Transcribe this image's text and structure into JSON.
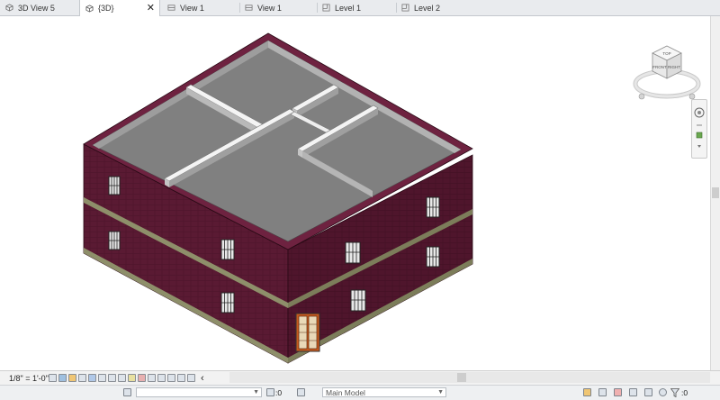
{
  "tabs": [
    {
      "label": "3D View 5",
      "active": false,
      "closable": false,
      "icon": "3d-view-icon"
    },
    {
      "label": "{3D}",
      "active": true,
      "closable": true,
      "icon": "3d-view-icon"
    },
    {
      "label": "View 1",
      "active": false,
      "closable": false,
      "icon": "section-view-icon"
    },
    {
      "label": "View 1",
      "active": false,
      "closable": false,
      "icon": "section-view-icon"
    },
    {
      "label": "Level 1",
      "active": false,
      "closable": false,
      "icon": "floor-plan-icon"
    },
    {
      "label": "Level 2",
      "active": false,
      "closable": false,
      "icon": "floor-plan-icon"
    }
  ],
  "close_glyph": "✕",
  "viewcube": {
    "top_label": "TOP",
    "front_label": "FRONT",
    "right_label": "RIGHT"
  },
  "view_control_bar": {
    "scale": "1/8\" = 1'-0\"",
    "collapse_arrow": "‹"
  },
  "status_bar": {
    "workset_value": "",
    "editable_count": ":0",
    "model_value": "Main Model",
    "filter_count": ":0"
  },
  "colors": {
    "wall_left": "#5a1a33",
    "wall_right": "#4d1329",
    "wall_top": "#6e2240",
    "band": "#8e8f6a",
    "floor": "#7f7f7f",
    "partition_top": "#f4f4f4",
    "door": "#c65a1e"
  }
}
